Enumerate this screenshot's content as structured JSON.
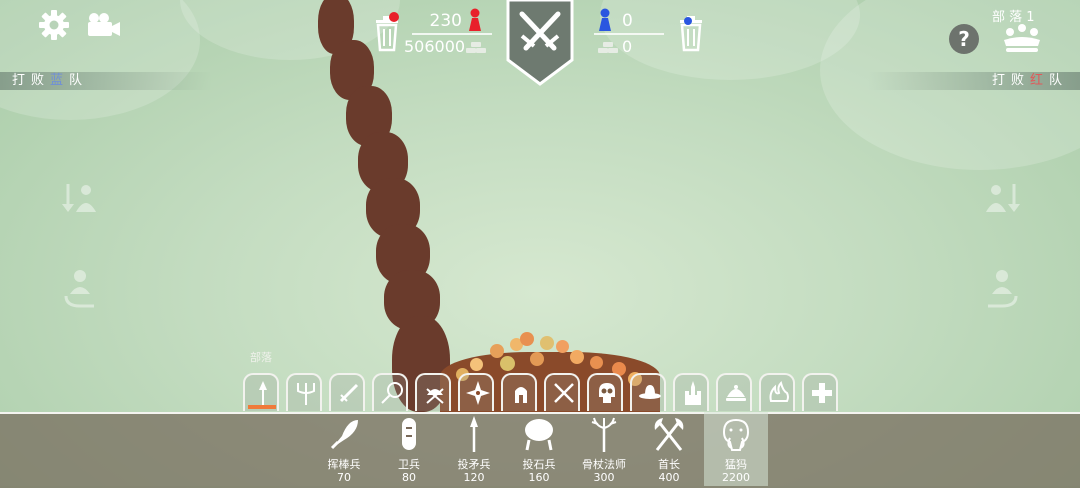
{
  "header": {
    "settings_icon": "gear-icon",
    "camera_icon": "camera-icon",
    "red_count": "230",
    "red_gold": "506000",
    "blue_count": "0",
    "blue_gold": "0",
    "center_icon": "crossed-swords-shield-icon",
    "help_icon": "question-icon",
    "faction_title": "部 落 1"
  },
  "defeat_left": {
    "prefix": "打败",
    "team": "蓝",
    "suffix": "队"
  },
  "defeat_right": {
    "prefix": "打败",
    "team": "红",
    "suffix": "队"
  },
  "faction_tab_caption": "部落",
  "faction_tabs": [
    {
      "icon": "spear-icon",
      "active": true
    },
    {
      "icon": "pitchfork-icon"
    },
    {
      "icon": "sword-icon"
    },
    {
      "icon": "lollipop-icon"
    },
    {
      "icon": "viking-helmet-icon"
    },
    {
      "icon": "shuriken-icon"
    },
    {
      "icon": "spartan-helmet-icon"
    },
    {
      "icon": "crossed-swords-icon"
    },
    {
      "icon": "skull-icon"
    },
    {
      "icon": "cowboy-hat-icon"
    },
    {
      "icon": "castle-icon"
    },
    {
      "icon": "tea-icon"
    },
    {
      "icon": "flames-icon"
    },
    {
      "icon": "plus-icon"
    }
  ],
  "units": [
    {
      "name": "挥棒兵",
      "cost": "70",
      "icon": "club-icon"
    },
    {
      "name": "卫兵",
      "cost": "80",
      "icon": "shield-guard-icon"
    },
    {
      "name": "投矛兵",
      "cost": "120",
      "icon": "spear-thrower-icon"
    },
    {
      "name": "投石兵",
      "cost": "160",
      "icon": "boulder-thrower-icon"
    },
    {
      "name": "骨杖法师",
      "cost": "300",
      "icon": "antler-staff-icon"
    },
    {
      "name": "首长",
      "cost": "400",
      "icon": "double-axe-icon"
    },
    {
      "name": "猛犸",
      "cost": "2200",
      "icon": "mammoth-icon",
      "selected": true
    }
  ],
  "colors": {
    "red_team": "#e8202a",
    "blue_team": "#2a56e0",
    "active_tab": "#f07a3a"
  }
}
